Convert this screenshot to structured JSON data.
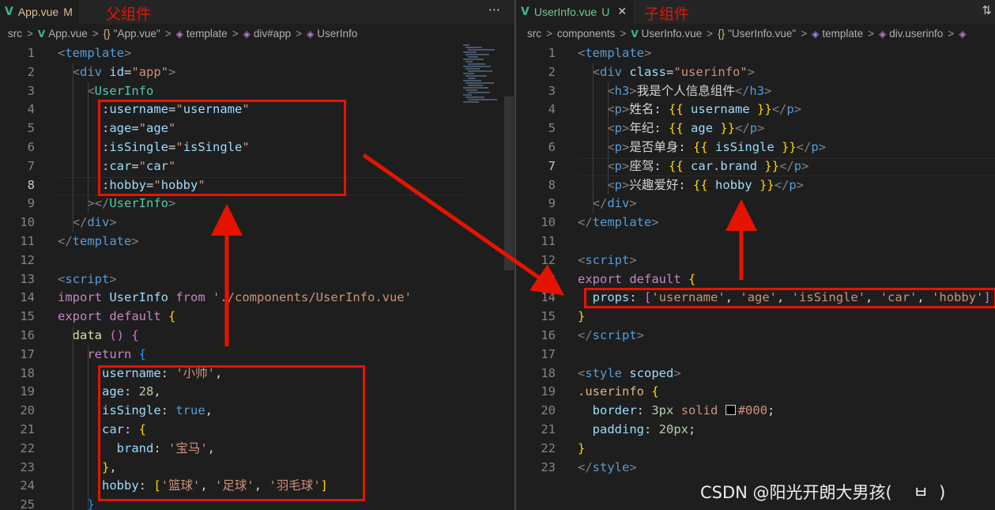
{
  "left": {
    "tab": {
      "label": "App.vue",
      "status": "M"
    },
    "note": "父组件",
    "more": "···",
    "breadcrumb": [
      "src",
      "App.vue",
      "\"App.vue\"",
      "template",
      "div#app",
      "UserInfo"
    ]
  },
  "right": {
    "tab": {
      "label": "UserInfo.vue",
      "status": "U",
      "close": "✕"
    },
    "note": "子组件",
    "breadcrumb": [
      "src",
      "components",
      "UserInfo.vue",
      "\"UserInfo.vue\"",
      "template",
      "div.userinfo"
    ]
  },
  "watermark": "CSDN @阳光开朗大男孩(    ㅂ  )",
  "colors": {
    "annotation_red": "#e51400",
    "editor_bg": "#1e1e1e",
    "vue_green": "#41b883"
  }
}
